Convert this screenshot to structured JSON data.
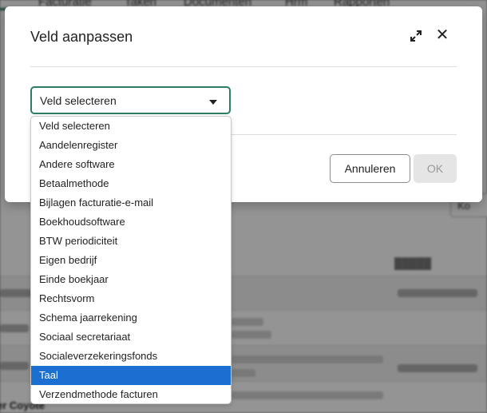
{
  "modal": {
    "title": "Veld aanpassen",
    "select_value": "Veld selecteren",
    "cancel_label": "Annuleren",
    "ok_label": "OK",
    "expand_icon": "expand-icon",
    "close_icon": "close-icon"
  },
  "dropdown": {
    "selected_index": 13,
    "options": [
      "Veld selecteren",
      "Aandelenregister",
      "Andere software",
      "Betaalmethode",
      "Bijlagen facturatie-e-mail",
      "Boekhoudsoftware",
      "BTW periodiciteit",
      "Eigen bedrijf",
      "Einde boekjaar",
      "Rechtsvorm",
      "Schema jaarrekening",
      "Sociaal secretariaat",
      "Socialeverzekeringsfonds",
      "Taal",
      "Verzendmethode facturen"
    ]
  },
  "background": {
    "nav_tabs": [
      "Facturatie",
      "Taken",
      "Documenten",
      "Hrm",
      "Rapporten"
    ],
    "button_label": "Ko",
    "row_name": "er Coyote"
  }
}
